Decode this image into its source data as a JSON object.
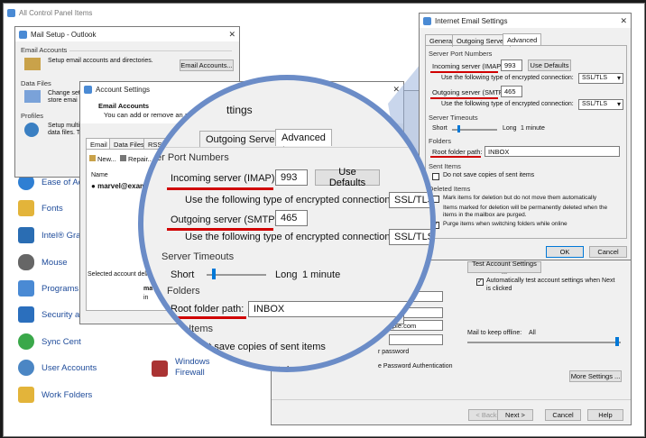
{
  "control_panel": {
    "title": "All Control Panel Items",
    "items": [
      {
        "label": "Ease of Ac",
        "icon": "ease-of-access-icon",
        "color": "#2f7fd3"
      },
      {
        "label": "Fonts",
        "icon": "fonts-icon",
        "color": "#e3b43a"
      },
      {
        "label": "Intel® Gra",
        "icon": "intel-graphics-icon",
        "color": "#2a6db3"
      },
      {
        "label": "Mouse",
        "icon": "mouse-icon",
        "color": "#666666"
      },
      {
        "label": "Programs",
        "icon": "programs-icon",
        "color": "#4a8ad4"
      },
      {
        "label": "Security an",
        "icon": "security-icon",
        "color": "#2b6fbd"
      },
      {
        "label": "Sync Cent",
        "icon": "sync-center-icon",
        "color": "#3aa84a"
      },
      {
        "label": "User Accounts",
        "icon": "user-accounts-icon",
        "color": "#4b86c4"
      },
      {
        "label": "Work Folders",
        "icon": "work-folders-icon",
        "color": "#e3b43a"
      }
    ],
    "windows_firewall": [
      "Windows",
      "Firewall"
    ]
  },
  "mail_setup": {
    "title": "Mail Setup - Outlook",
    "email_accounts_header": "Email Accounts",
    "email_accounts_desc": "Setup email accounts and directories.",
    "email_accounts_btn": "Email Accounts...",
    "data_files_header": "Data Files",
    "data_files_desc1": "Change set",
    "data_files_desc2": "store emai",
    "profiles_header": "Profiles",
    "profiles_desc1": "Setup multi",
    "profiles_desc2": "data files. Ty"
  },
  "account_settings": {
    "title": "Account Settings",
    "header": "Email Accounts",
    "desc": "You can add or remove an account. You can",
    "tabs": [
      "Email",
      "Data Files",
      "RSS Feeds"
    ],
    "toolbar_new": "New...",
    "toolbar_repair": "Repair...",
    "col_name": "Name",
    "account": "marvel@exampl",
    "selected_text": "Selected account deli",
    "partial_ma": "ma",
    "partial_in": "in"
  },
  "change_account": {
    "test_btn": "Test Account Settings ...",
    "auto_test_line1": "Automatically test account settings when Next",
    "auto_test_line2": "is clicked",
    "email_partial": "ple.com",
    "password_partial": "r password",
    "spa_partial": "e Password Authentication",
    "offline_label": "Mail to keep offline:",
    "offline_value": "All",
    "more_settings_btn": "More Settings ...",
    "back_btn": "< Back",
    "next_btn": "Next >",
    "cancel_btn": "Cancel",
    "help_btn": "Help"
  },
  "internet_email": {
    "title": "Internet Email Settings",
    "tabs": [
      "General",
      "Outgoing Server",
      "Advanced"
    ],
    "server_port_numbers": "Server Port Numbers",
    "incoming_label": "Incoming server (IMAP):",
    "incoming_value": "993",
    "use_defaults_btn": "Use Defaults",
    "encryption_label": "Use the following type of encrypted connection:",
    "encryption_value": "SSL/TLS",
    "outgoing_label": "Outgoing server (SMTP):",
    "outgoing_value": "465",
    "server_timeouts": "Server Timeouts",
    "short_label": "Short",
    "long_label": "Long",
    "timeout_value": "1 minute",
    "folders_header": "Folders",
    "root_folder_label": "Root folder path:",
    "root_folder_value": "INBOX",
    "sent_items_header": "Sent Items",
    "sent_items_option": "Do not save copies of sent items",
    "deleted_items_header": "Deleted Items",
    "deleted_opt1": "Mark items for deletion but do not move them automatically",
    "deleted_note1": "Items marked for deletion will be permanently deleted when the",
    "deleted_note2": "items in the mailbox are purged.",
    "deleted_opt2": "Purge items when switching folders while online",
    "ok_btn": "OK",
    "cancel_btn": "Cancel"
  },
  "magnifier": {
    "partial_title": "ttings",
    "tab_outgoing": "Outgoing Server",
    "tab_advanced": "Advanced",
    "server_port_numbers": "er Port Numbers",
    "incoming_label": "Incoming server (IMAP):",
    "incoming_value": "993",
    "use_defaults_btn": "Use Defaults",
    "encryption_label": "Use the following type of encrypted connection:",
    "encryption_value": "SSL/TLS",
    "outgoing_label": "Outgoing server (SMTP):",
    "outgoing_value": "465",
    "server_timeouts": "Server Timeouts",
    "short_label": "Short",
    "long_label": "Long",
    "timeout_value": "1 minute",
    "folders_header": "Folders",
    "root_folder_label": "Root folder path:",
    "root_folder_value": "INBOX",
    "sent_items_header": "t Items",
    "sent_items_option": "not save copies of sent items",
    "deleted_partial": "ation but do n"
  },
  "colors": {
    "highlight_red": "#d00000",
    "magnifier_ring": "#6b8cc7",
    "window_bg": "#f0f0f0",
    "link_blue": "#1e4b9a"
  }
}
